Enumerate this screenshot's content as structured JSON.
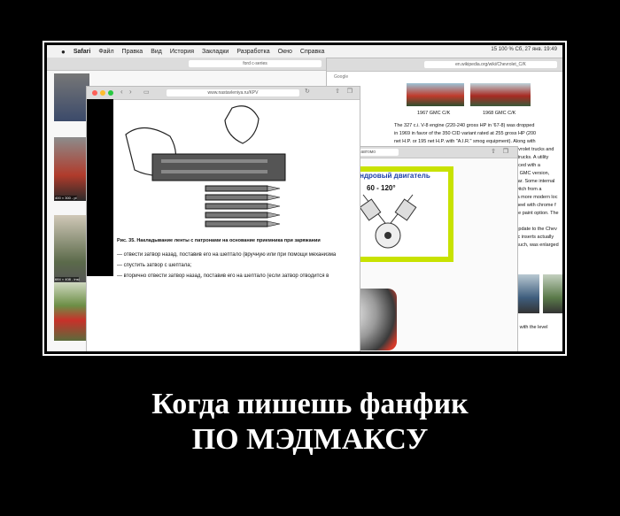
{
  "menubar": {
    "items": [
      "Safari",
      "Файл",
      "Правка",
      "Вид",
      "История",
      "Закладки",
      "Разработка",
      "Окно",
      "Справка"
    ],
    "status": "15    100 %    Сб, 27 янв. 19:49"
  },
  "back_window": {
    "url": "ford c-series",
    "thumb_labels": [
      "400 × 300 - pl",
      "684 × 408 - insi"
    ]
  },
  "wiki_window": {
    "url": "en.wikipedia.org/wiki/Chevrolet_C/K",
    "search": "Google",
    "captions": [
      "1967 GMC C/K",
      "1968 GMC C/K"
    ],
    "lines": [
      "The 327 c.i. V-8 engine (220-240 gross HP in '67-8) was dropped",
      "in 1969 in favor of the 350 CID variant rated at 255 gross HP (200",
      "net H.P. or 195 net H.P. with \"A.I.R.\" smog equipment). Along with",
      "hevrolet trucks and",
      "C trucks. A utility",
      "duced with a",
      "he GMC version,",
      "year. Some internal",
      "switch from a",
      "d a more modern loc",
      "wheel with chrome f",
      "one paint option. The",
      "r update to the Chev",
      "stic inserts actually",
      "s such, was enlarged"
    ],
    "bottom": "10 with the level"
  },
  "front_window": {
    "url": "www.nastavleniya.ru/KPV",
    "fig_caption": "Рис. 35. Накладывание ленты с патронами на основание приемника при заряжании",
    "steps": [
      "— отвести затвор назад, поставив его на шептало (вручную или при помощи механизма",
      "— спустить затвор с шептала;",
      "— вторично отвести затвор назад, поставив его на шептало (если затвор отводится в"
    ]
  },
  "engine_window": {
    "url": "устройство-автомо",
    "title": "ый шестицилиндровый двигатель",
    "angle": "60 - 120°",
    "cylinders": [
      "2",
      "3",
      "5",
      "6"
    ]
  },
  "caption": {
    "line1": "Когда пишешь фанфик",
    "line2": "ПО МЭДМАКСУ"
  }
}
